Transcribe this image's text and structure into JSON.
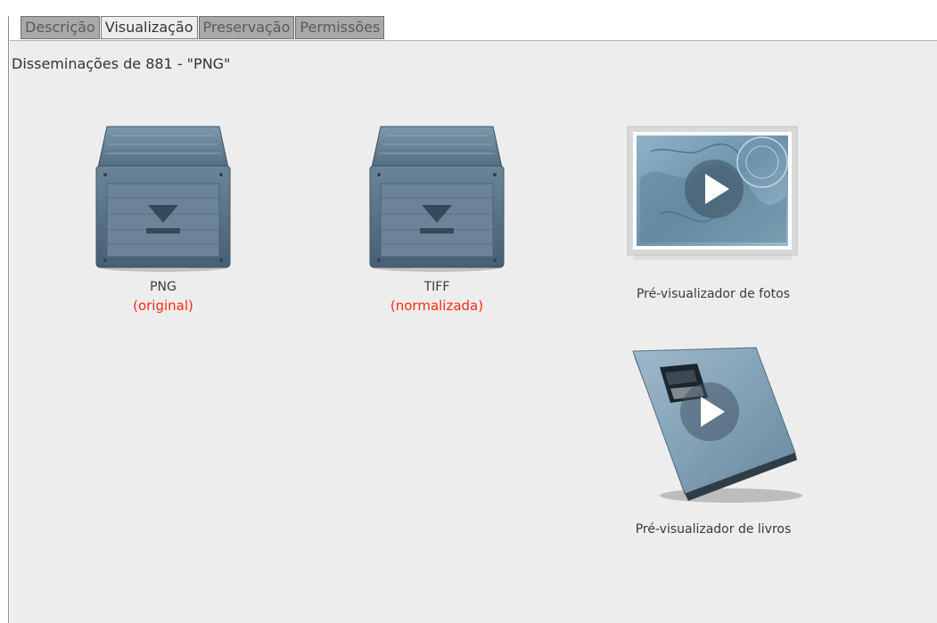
{
  "tabs": [
    {
      "label": "Descrição"
    },
    {
      "label": "Visualização"
    },
    {
      "label": "Preservação"
    },
    {
      "label": "Permissões"
    }
  ],
  "active_tab": "Visualização",
  "panel": {
    "title": "Disseminações de 881 - \"PNG\""
  },
  "items": [
    {
      "icon": "package-download-icon",
      "label": "PNG",
      "status": "(original)"
    },
    {
      "icon": "package-download-icon",
      "label": "TIFF",
      "status": "(normalizada)"
    },
    {
      "icon": "photo-preview-icon",
      "label": "Pré-visualizador de fotos"
    },
    {
      "icon": "book-preview-icon",
      "label": "Pré-visualizador de livros"
    }
  ],
  "colors": {
    "status_text": "#ff2a12",
    "panel_background": "#ededed",
    "inactive_tab": "#a9a9a9"
  }
}
